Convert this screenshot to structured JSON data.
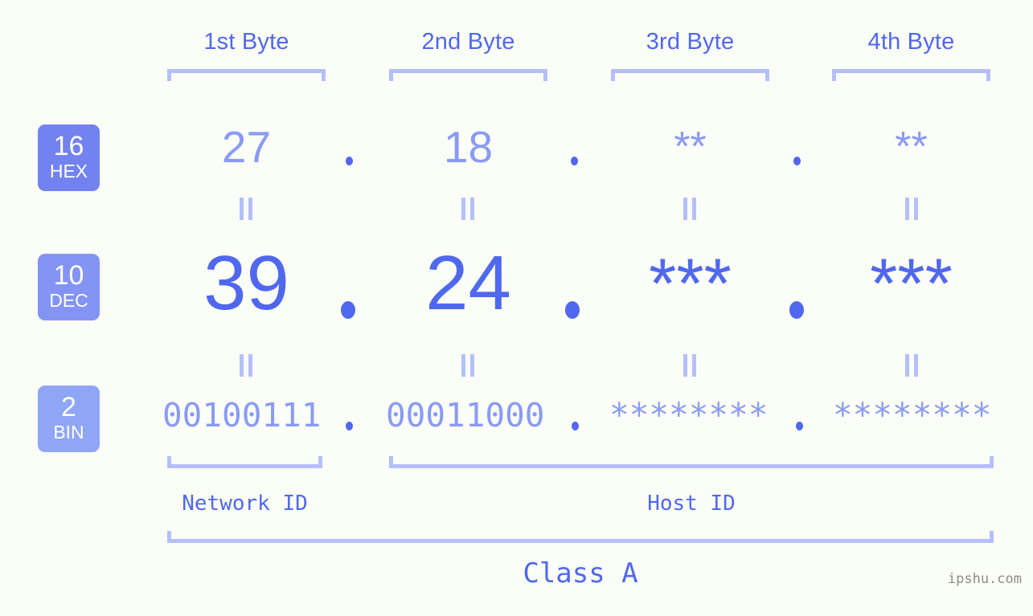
{
  "background_color": "#fbfdf7",
  "accent_color": "#5068ee",
  "accent_light_color": "#8a9bf5",
  "bracket_color": "#b4c0fb",
  "headers": [
    {
      "label": "1st Byte"
    },
    {
      "label": "2nd Byte"
    },
    {
      "label": "3rd Byte"
    },
    {
      "label": "4th Byte"
    }
  ],
  "radix_badges": [
    {
      "number": "16",
      "abbr": "HEX",
      "color": "#7283ef"
    },
    {
      "number": "10",
      "abbr": "DEC",
      "color": "#8494f4"
    },
    {
      "number": "2",
      "abbr": "BIN",
      "color": "#8fa6f7"
    }
  ],
  "rows": {
    "hex": {
      "values": [
        "27",
        "18",
        "**",
        "**"
      ],
      "separator": "."
    },
    "dec": {
      "values": [
        "39",
        "24",
        "***",
        "***"
      ],
      "separator": "."
    },
    "bin": {
      "values": [
        "00100111",
        "00011000",
        "********",
        "********"
      ],
      "separator": "."
    }
  },
  "equals_glyph": "||",
  "segments": {
    "network_id": "Network ID",
    "host_id": "Host ID"
  },
  "class_label": "Class A",
  "watermark": "ipshu.com"
}
